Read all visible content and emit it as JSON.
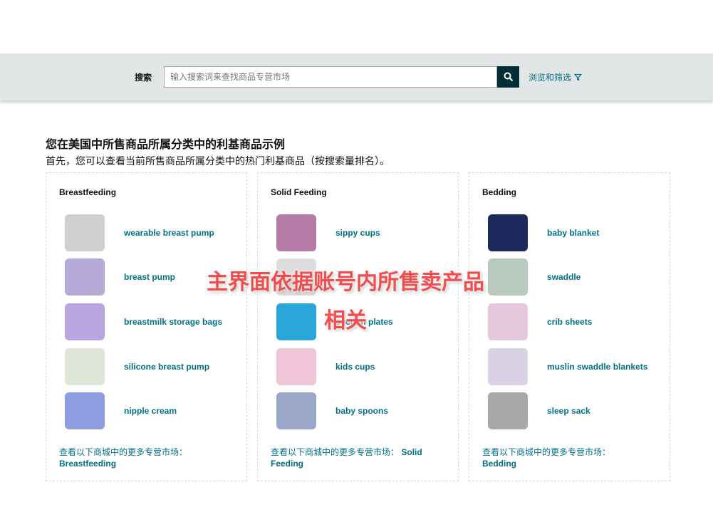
{
  "search": {
    "label": "搜索",
    "placeholder": "输入搜索词来查找商品专营市场",
    "browse": "浏览和筛选"
  },
  "heading": "您在美国中所售商品所属分类中的利基商品示例",
  "subheading": "首先，您可以查看当前所售商品所属分类中的热门利基商品（按搜索量排名）。",
  "more_prefix": "查看以下商城中的更多专营市场：",
  "cards": [
    {
      "title": "Breastfeeding",
      "items": [
        {
          "label": "wearable breast pump",
          "color": "#cfcfcf"
        },
        {
          "label": "breast pump",
          "color": "#b7a9d8"
        },
        {
          "label": "breastmilk storage bags",
          "color": "#b9a6e0"
        },
        {
          "label": "silicone breast pump",
          "color": "#dfe6d8"
        },
        {
          "label": "nipple cream",
          "color": "#8f9de0"
        }
      ]
    },
    {
      "title": "Solid Feeding",
      "items": [
        {
          "label": "sippy cups",
          "color": "#b57aa6"
        },
        {
          "label": "",
          "color": "#dddddd"
        },
        {
          "label": "suction plates",
          "color": "#2aa6d8"
        },
        {
          "label": "kids cups",
          "color": "#f0c5d8"
        },
        {
          "label": "baby spoons",
          "color": "#9aa7c9"
        }
      ]
    },
    {
      "title": "Bedding",
      "items": [
        {
          "label": "baby blanket",
          "color": "#1c2a5e"
        },
        {
          "label": "swaddle",
          "color": "#b9c9c0"
        },
        {
          "label": "crib sheets",
          "color": "#e6c8dc"
        },
        {
          "label": "muslin swaddle blankets",
          "color": "#d9d2e6"
        },
        {
          "label": "sleep sack",
          "color": "#a8a8a8"
        }
      ]
    }
  ],
  "overlay": {
    "line1": "主界面依据账号内所售卖产品",
    "line2": "相关"
  }
}
